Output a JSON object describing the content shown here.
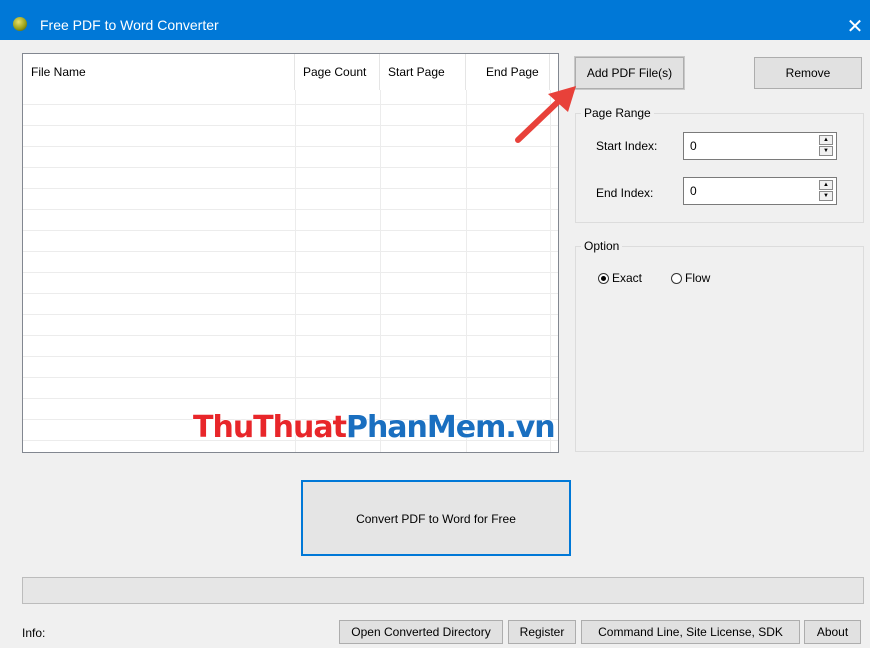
{
  "window": {
    "title": "Free PDF to Word Converter",
    "close_glyph": "✕",
    "app_icon": "app-logo-icon"
  },
  "file_list": {
    "columns": [
      "File Name",
      "Page Count",
      "Start Page",
      "End Page"
    ],
    "rows": []
  },
  "buttons": {
    "add_pdf": "Add PDF File(s)",
    "remove": "Remove",
    "convert": "Convert PDF to Word for Free"
  },
  "page_range": {
    "label": "Page Range",
    "start_label": "Start Index:",
    "start_value": "0",
    "end_label": "End Index:",
    "end_value": "0"
  },
  "option": {
    "label": "Option",
    "choices": [
      "Exact",
      "Flow"
    ],
    "selected": "Exact"
  },
  "watermark": {
    "part1": "ThuThuat",
    "part2": "PhanMem",
    "part3": ".vn"
  },
  "status": {
    "info_label": "Info:",
    "progress": 0
  },
  "footer_buttons": [
    "Open Converted Directory",
    "Register",
    "Command Line, Site License, SDK",
    "About"
  ],
  "colors": {
    "titlebar": "#0078d7",
    "convert_border": "#0078d7",
    "arrow": "#e8413a",
    "watermark_red": "#e8262a",
    "watermark_blue": "#1a6fc0"
  }
}
